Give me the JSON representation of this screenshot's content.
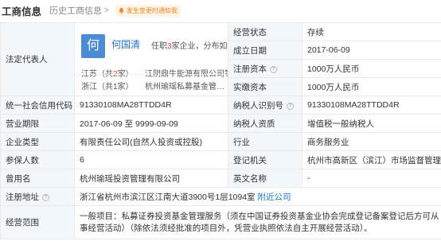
{
  "header": {
    "title": "工商信息",
    "history_link": "历史工商信息",
    "history_chevron": ">",
    "badge": "发生变更时通知我",
    "badge_icon": "bell-icon",
    "badge_color": "#f08a24"
  },
  "legal_rep": {
    "label": "法定代表人",
    "avatar_char": "何",
    "name": "何国清",
    "role_pre": "任职",
    "role_count": "3",
    "role_post": "家企业，分布如下",
    "region1_pre": "江苏（共",
    "region1_count": "2",
    "region1_post": "家）",
    "region1_company": "江阴鼎牛能源有限公司等",
    "region2": "浙江（共1家）",
    "region2_company": "杭州瑜瑶私募基金管…",
    "accent": "#1f73c8"
  },
  "fields": {
    "status_label": "经营状态",
    "status_value": "存续",
    "established_label": "成立日期",
    "established_value": "2017-06-09",
    "reg_capital_label": "注册资本",
    "reg_capital_value": "1000万人民币",
    "paid_capital_label": "实缴资本",
    "paid_capital_value": "1000万人民币",
    "credit_code_label": "统一社会信用代码",
    "credit_code_value": "91330108MA28TTDD4R",
    "taxpayer_id_label": "纳税人识别号",
    "taxpayer_id_value": "91330108MA28TTDD4R",
    "term_label": "营业期限",
    "term_value": "2017-06-09 至 9999-09-09",
    "taxpayer_qual_label": "纳税人资质",
    "taxpayer_qual_value": "增值税一般纳税人",
    "type_label": "企业类型",
    "type_value": "有限责任公司(自然人投资或控股)",
    "industry_label": "行业",
    "industry_value": "商务服务业",
    "insured_label": "参保人数",
    "insured_value": "6",
    "authority_label": "登记机关",
    "authority_value": "杭州市高新区（滨江）市场监督管理局",
    "former_name_label": "曾用名",
    "former_name_value": "杭州瑜瑶投资管理有限公司",
    "english_name_label": "英文名称",
    "english_name_value": "-",
    "address_label": "注册地址",
    "address_value": "浙江省杭州市滨江区江南大道3900号1层1094室",
    "nearby_link": "附近公司",
    "scope_label": "经营范围",
    "scope_value": "一般项目：私募证券投资基金管理服务（须在中国证券投资基金业协会完成登记备案登记后方可从事经营活动）（除依法须经批准的项目外，凭营业执照依法自主开展经营活动）。"
  },
  "help_icon": "question-circle-icon"
}
